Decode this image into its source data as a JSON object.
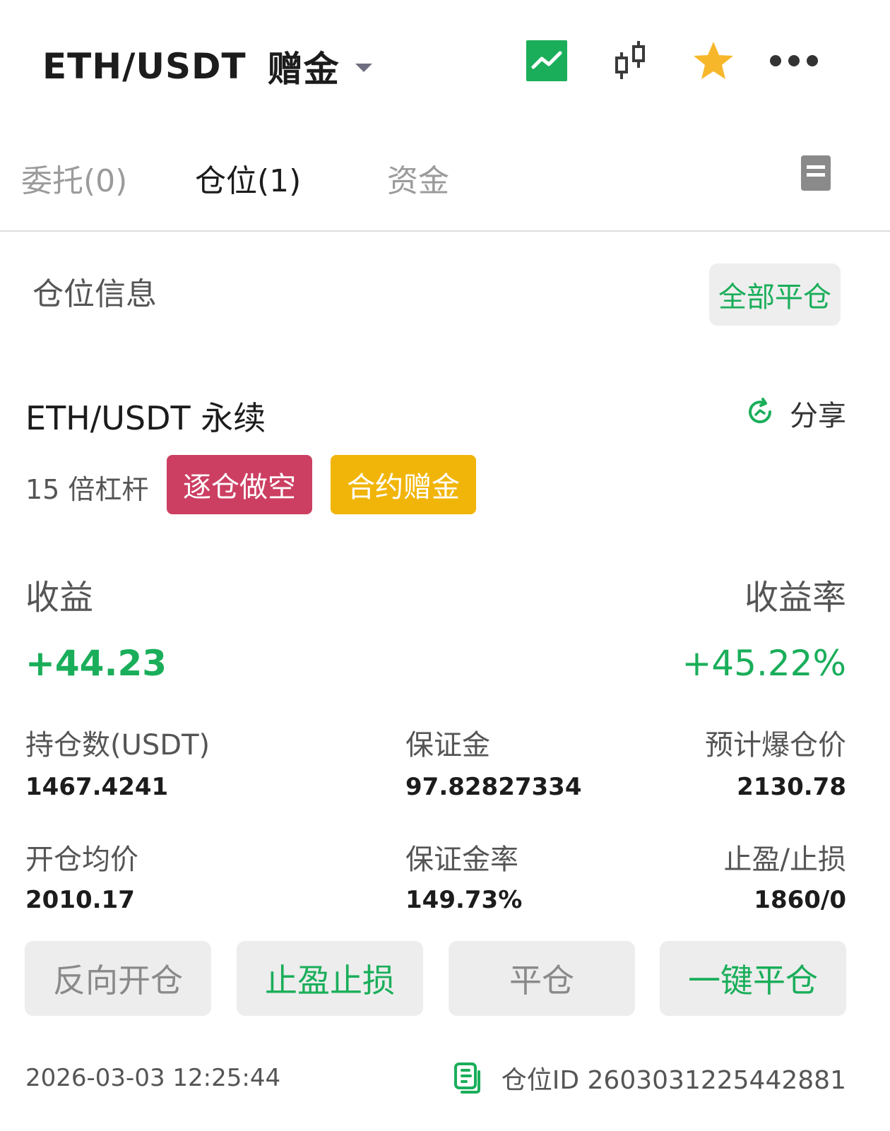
{
  "header": {
    "pair": "ETH/USDT",
    "account_type": "赠金",
    "icons": [
      "chart-icon",
      "candlestick-icon",
      "star-icon",
      "more-icon"
    ],
    "colors": {
      "chart_icon_bg": "#1aae5a",
      "star": "#f7b72a"
    }
  },
  "tabs": [
    {
      "label": "委托(0)",
      "active": false
    },
    {
      "label": "仓位(1)",
      "active": true
    },
    {
      "label": "资金",
      "active": false
    }
  ],
  "position_info": {
    "title": "仓位信息",
    "close_all_label": "全部平仓"
  },
  "position": {
    "contract": "ETH/USDT 永续",
    "share_label": "分享",
    "leverage": "15 倍杠杆",
    "tags": [
      {
        "label": "逐仓做空",
        "color": "#cc3f62"
      },
      {
        "label": "合约赠金",
        "color": "#f1b50a"
      }
    ],
    "pnl_label": "收益",
    "pnl_rate_label": "收益率",
    "pnl_value": "+44.23",
    "pnl_rate_value": "+45.22%",
    "stats": {
      "size_label": "持仓数(USDT)",
      "size_value": "1467.4241",
      "margin_label": "保证金",
      "margin_value": "97.82827334",
      "liq_label": "预计爆仓价",
      "liq_value": "2130.78",
      "entry_label": "开仓均价",
      "entry_value": "2010.17",
      "margin_ratio_label": "保证金率",
      "margin_ratio_value": "149.73%",
      "tpsl_label": "止盈/止损",
      "tpsl_value": "1860/0"
    },
    "actions": {
      "reverse": "反向开仓",
      "tpsl": "止盈止损",
      "close": "平仓",
      "one_click_close": "一键平仓"
    },
    "timestamp": "2026-03-03 12:25:44",
    "position_id": "仓位ID 2603031225442881"
  },
  "colors": {
    "accent_green": "#1aae5a",
    "text_dark": "#1c1c1c",
    "text_gray": "#555555"
  }
}
